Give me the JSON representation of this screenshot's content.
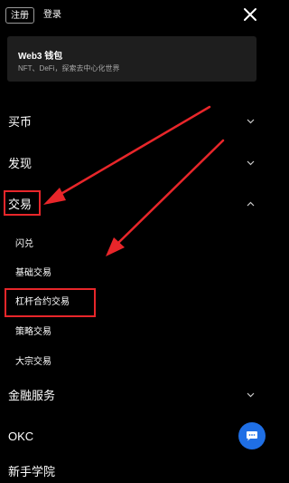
{
  "header": {
    "register_label": "注册",
    "login_label": "登录"
  },
  "web3_card": {
    "title": "Web3 钱包",
    "subtitle": "NFT、DeFi，探索去中心化世界"
  },
  "menu": {
    "buy": "买币",
    "discover": "发现",
    "trade": "交易",
    "trade_sub": [
      "闪兑",
      "基础交易",
      "杠杆合约交易",
      "策略交易",
      "大宗交易"
    ],
    "finance": "金融服务",
    "okc": "OKC",
    "academy": "新手学院"
  },
  "colors": {
    "background": "#000000",
    "card": "#1e1e1e",
    "annotation_red": "#e8262a",
    "fab_blue": "#1f6fe5"
  }
}
